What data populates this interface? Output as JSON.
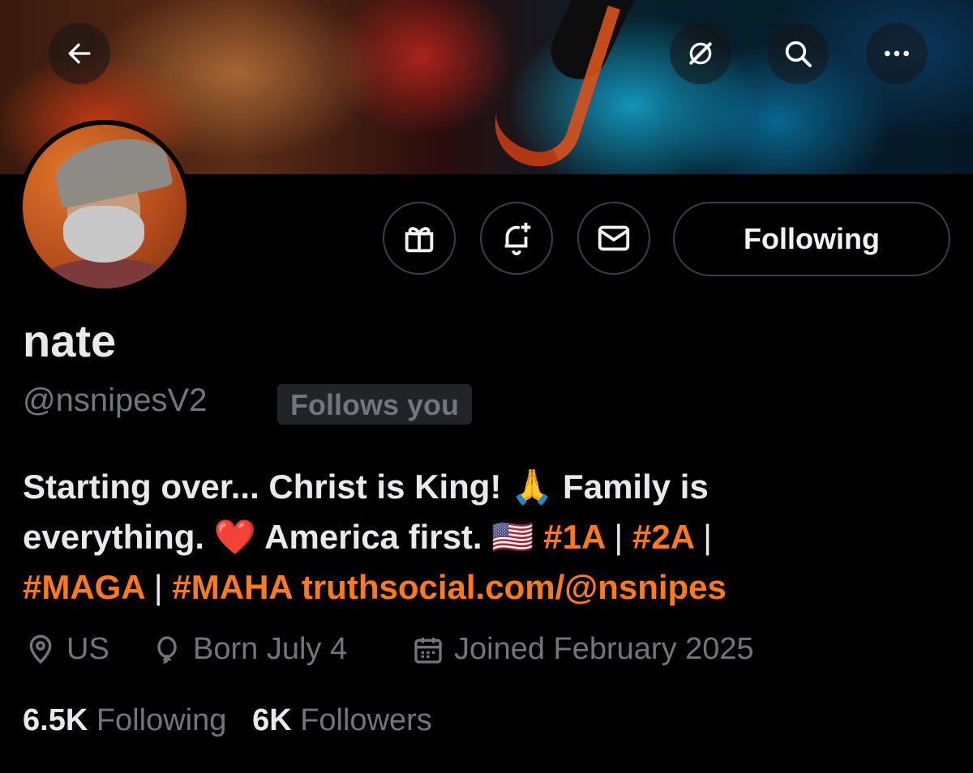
{
  "profile": {
    "name": "nate",
    "handle": "@nsnipesV2",
    "follows_you": "Follows you",
    "follow_button": "Following",
    "bio": {
      "line1": "Starting over... Christ is King! 🙏 Family is",
      "line2_text": "everything. ❤️ America first. 🇺🇸",
      "tag_1a": "#1A",
      "tag_2a": "#2A",
      "tag_maga": "#MAGA",
      "tag_maha": "#MAHA",
      "link": "truthsocial.com/@nsnipes",
      "separator": "|"
    },
    "location": "US",
    "birthday": "Born July 4",
    "joined": "Joined February 2025",
    "following_count": "6.5K",
    "following_label": "Following",
    "followers_count": "6K",
    "followers_label": "Followers"
  },
  "icons": {
    "back": "arrow-left-icon",
    "grok": "grok-icon",
    "search": "search-icon",
    "more": "more-icon",
    "gift": "gift-icon",
    "notify": "bell-plus-icon",
    "message": "envelope-icon",
    "location": "location-pin-icon",
    "birthday": "balloon-icon",
    "joined": "calendar-icon"
  },
  "colors": {
    "accent": "#ff7a1a",
    "muted": "#71767b",
    "text": "#e7e9ea",
    "background": "#000000"
  }
}
